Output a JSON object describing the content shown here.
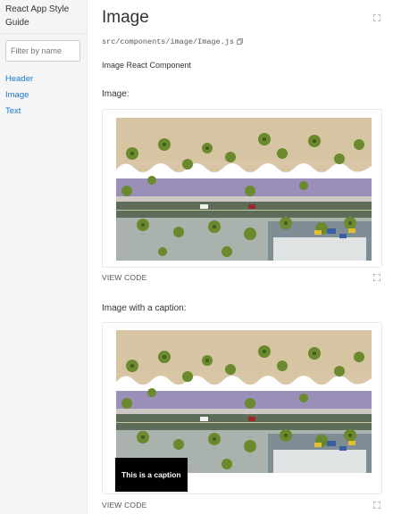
{
  "sidebar": {
    "app_title": "React App Style Guide",
    "filter_placeholder": "Filter by name",
    "items": [
      {
        "label": "Header"
      },
      {
        "label": "Image"
      },
      {
        "label": "Text"
      }
    ]
  },
  "component": {
    "name": "Image",
    "path": "src/components/image/Image.js",
    "description": "Image React Component"
  },
  "examples": [
    {
      "title": "Image:",
      "view_code": "VIEW CODE"
    },
    {
      "title": "Image with a caption:",
      "view_code": "VIEW CODE",
      "caption": "This is a caption"
    }
  ],
  "colors": {
    "link": "#1978c8",
    "sidebar_bg": "#f5f5f5",
    "border": "#e8e8e8"
  },
  "icons": [
    "isolate-icon",
    "copy-icon"
  ]
}
